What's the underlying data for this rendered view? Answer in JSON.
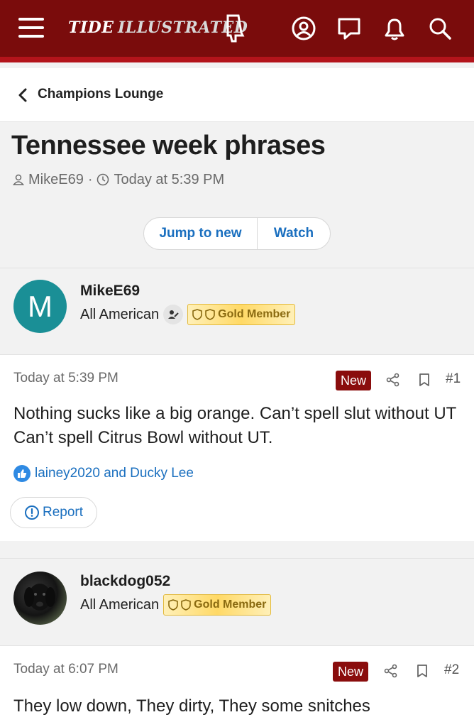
{
  "header": {
    "logo_part1": "TIDE",
    "logo_part2": "ILLUSTRATED",
    "icons": [
      "menu-icon",
      "account-icon",
      "messages-icon",
      "alerts-icon",
      "search-icon"
    ]
  },
  "breadcrumb": {
    "label": "Champions Lounge"
  },
  "thread": {
    "title": "Tennessee week phrases",
    "author": "MikeE69",
    "separator": "·",
    "time": "Today at 5:39 PM",
    "jump_label": "Jump to new",
    "watch_label": "Watch"
  },
  "posts": [
    {
      "avatar_letter": "M",
      "username": "MikeE69",
      "user_title": "All American",
      "badge": "Gold Member",
      "time": "Today at 5:39 PM",
      "new_label": "New",
      "number": "#1",
      "body": "Nothing sucks like a big orange. Can’t spell slut without UT Can’t spell Citrus Bowl without UT.",
      "likes": "lainey2020 and Ducky Lee",
      "report_label": "Report"
    },
    {
      "username": "blackdog052",
      "user_title": "All American",
      "badge": "Gold Member",
      "time": "Today at 6:07 PM",
      "new_label": "New",
      "number": "#2",
      "body": "They low down, They dirty, They some snitches"
    }
  ],
  "colors": {
    "header_bg": "#7a0c0c",
    "header_stripe": "#b3141b",
    "link": "#1a6fbf",
    "new_badge": "#8a0d0d",
    "avatar_teal": "#1a8f96",
    "gold_badge": "#ffd966"
  }
}
